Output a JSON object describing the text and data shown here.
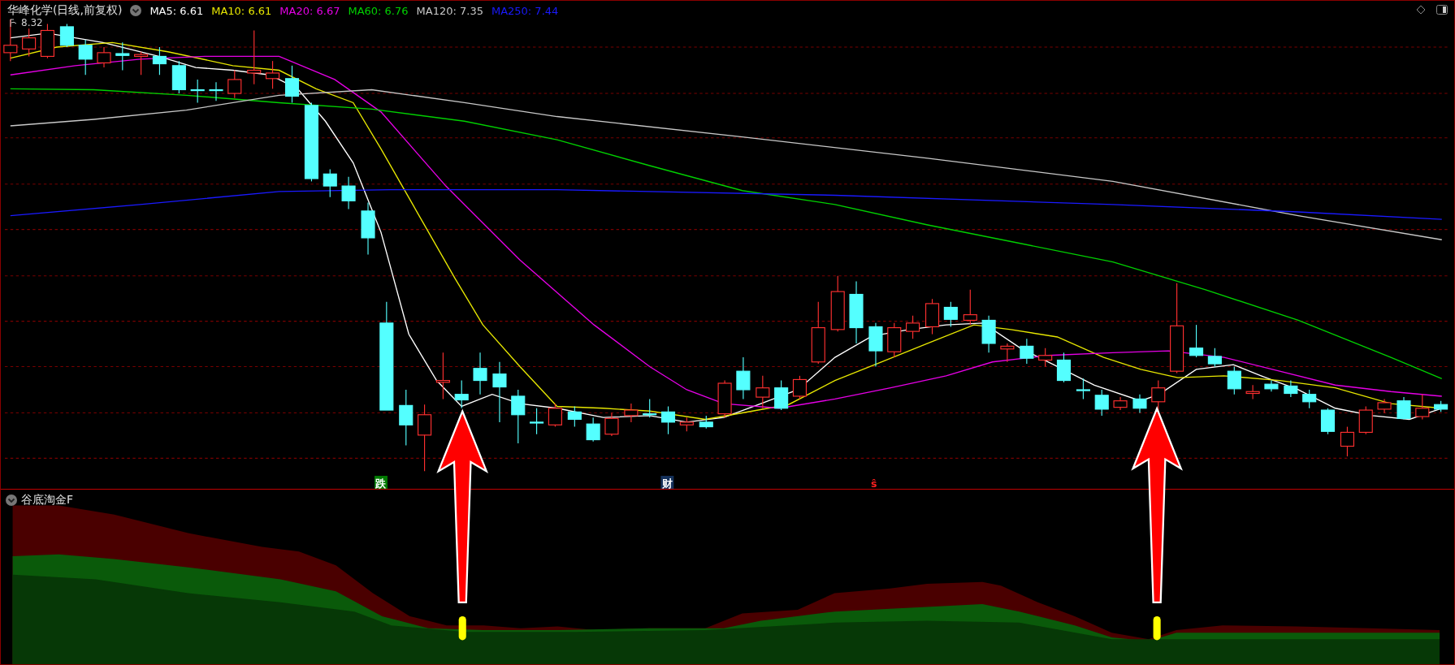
{
  "chart": {
    "title": "华峰化学(日线,前复权)",
    "ma_legend": [
      {
        "label": "MA5: 6.61",
        "color": "#ffffff"
      },
      {
        "label": "MA10: 6.61",
        "color": "#e6e600"
      },
      {
        "label": "MA20: 6.67",
        "color": "#e600e6"
      },
      {
        "label": "MA60: 6.76",
        "color": "#00d000"
      },
      {
        "label": "MA120: 7.35",
        "color": "#c8c8c8"
      },
      {
        "label": "MA250: 7.44",
        "color": "#1a1aff"
      }
    ],
    "high_label": "8.32",
    "event_markers": [
      {
        "text": "跌",
        "kind": "fall"
      },
      {
        "text": "财",
        "kind": "finance"
      },
      {
        "text": "ŝ",
        "kind": "signal"
      }
    ]
  },
  "indicator": {
    "title": "谷底淘金F"
  }
}
